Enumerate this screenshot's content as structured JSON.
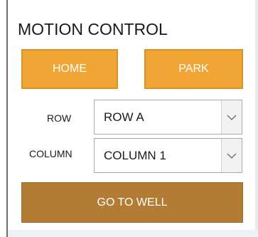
{
  "panel": {
    "title": "MOTION CONTROL"
  },
  "buttons": {
    "home_label": "HOME",
    "park_label": "PARK",
    "go_to_well_label": "GO TO WELL"
  },
  "row_select": {
    "label": "ROW",
    "value": "ROW A",
    "icon": "chevron-down-icon"
  },
  "column_select": {
    "label": "COLUMN",
    "value": "COLUMN 1",
    "icon": "chevron-down-icon"
  },
  "colors": {
    "accent_orange": "#f0a535",
    "go_button_brown": "#b27c35",
    "button_text": "#ffffff"
  }
}
